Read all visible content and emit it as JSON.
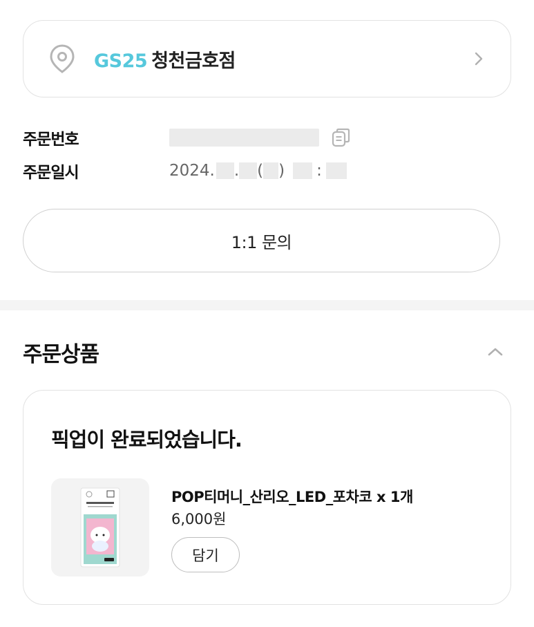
{
  "store": {
    "brand": "GS25",
    "branch": "청천금호점",
    "brand_color": "#56c8dc",
    "icon": "location-pin-icon",
    "chevron": "chevron-right-icon"
  },
  "order_info": {
    "number_label": "주문번호",
    "date_label": "주문일시",
    "date_year": "2024.",
    "date_dot": ".",
    "date_paren_open": "(",
    "date_paren_close": ")",
    "date_colon": ":",
    "copy_icon": "copy-icon"
  },
  "inquiry_button": {
    "label": "1:1 문의"
  },
  "ordered_items": {
    "title": "주문상품",
    "collapse_icon": "chevron-up-icon",
    "status": "픽업이 완료되었습니다.",
    "items": [
      {
        "name": "POP티머니_산리오_LED_포차코 x 1개",
        "price": "6,000원",
        "cart_label": "담기",
        "thumbnail": "product-thumbnail"
      }
    ]
  }
}
